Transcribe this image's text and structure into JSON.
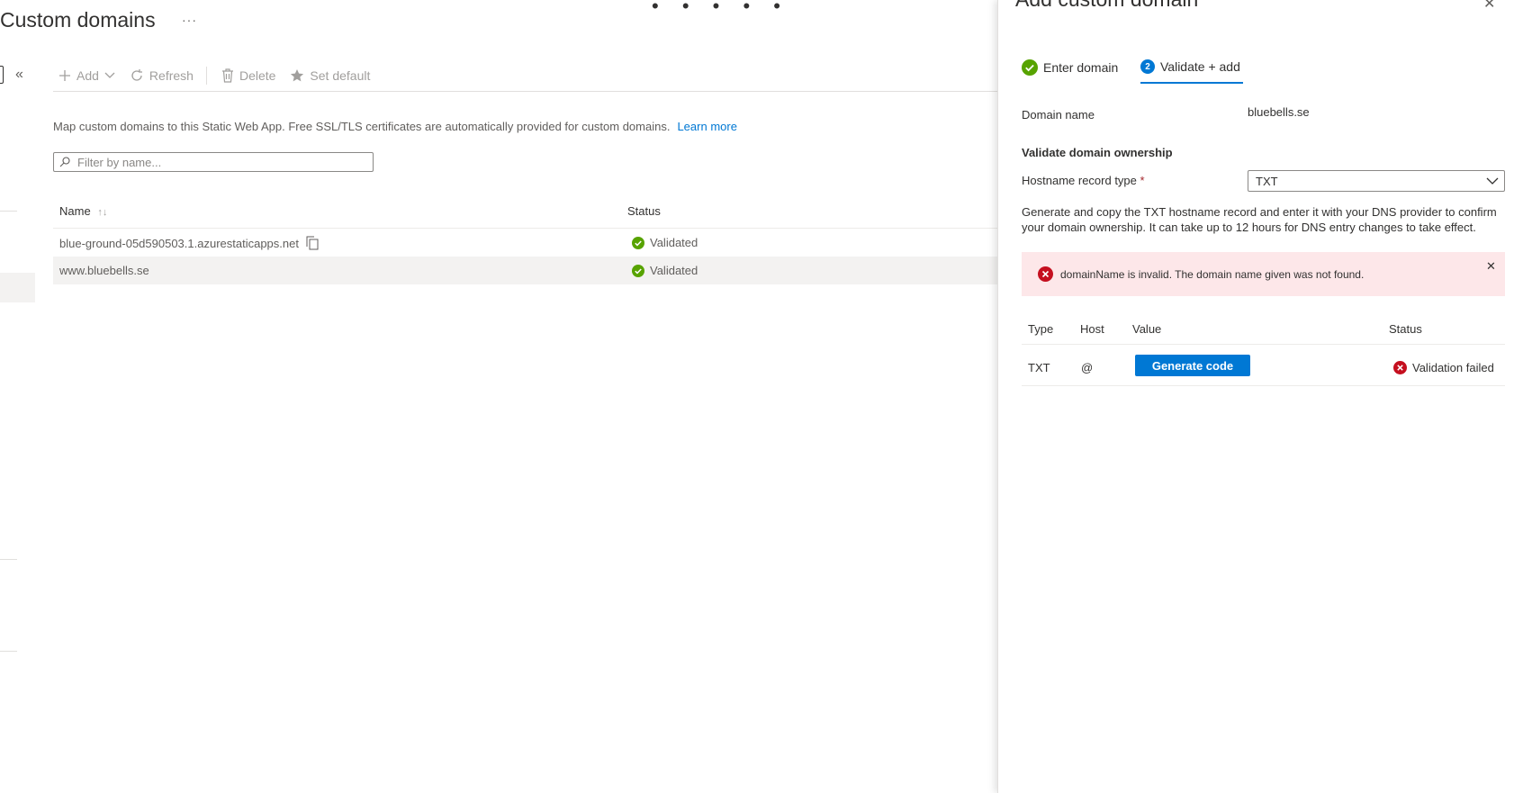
{
  "blade": {
    "title": "Custom domains",
    "more": "···",
    "top_dots": "• • • • •",
    "collapse": "«",
    "toolbar": {
      "add": "Add",
      "refresh": "Refresh",
      "delete": "Delete",
      "set_default": "Set default"
    },
    "description": "Map custom domains to this Static Web App. Free SSL/TLS certificates are automatically provided for custom domains.",
    "learn_more": "Learn more",
    "filter_placeholder": "Filter by name...",
    "table": {
      "columns": {
        "name": "Name",
        "status": "Status"
      },
      "sort_indicator": "↑↓",
      "rows": [
        {
          "name": "blue-ground-05d590503.1.azurestaticapps.net",
          "status": "Validated"
        },
        {
          "name": "www.bluebells.se",
          "status": "Validated"
        }
      ]
    }
  },
  "panel": {
    "title": "Add custom domain",
    "close": "✕",
    "steps": [
      {
        "label": "Enter domain",
        "state": "complete"
      },
      {
        "number": "2",
        "label": "Validate + add",
        "state": "active"
      }
    ],
    "domain_name_label": "Domain name",
    "domain_name_value": "bluebells.se",
    "section_title": "Validate domain ownership",
    "record_type_label": "Hostname record type",
    "required_mark": "*",
    "record_type_value": "TXT",
    "info_text": "Generate and copy the TXT hostname record and enter it with your DNS provider to confirm your domain ownership. It can take up to 12 hours for DNS entry changes to take effect.",
    "error_message": "domainName is invalid.  The domain name given was not found.",
    "error_close": "✕",
    "record_table": {
      "columns": {
        "type": "Type",
        "host": "Host",
        "value": "Value",
        "status": "Status"
      },
      "row": {
        "type": "TXT",
        "host": "@",
        "button": "Generate code",
        "status": "Validation failed"
      }
    }
  },
  "colors": {
    "accent": "#0078d4",
    "success": "#57a300",
    "error": "#c50f1f",
    "error_bg": "#fde7e9"
  }
}
